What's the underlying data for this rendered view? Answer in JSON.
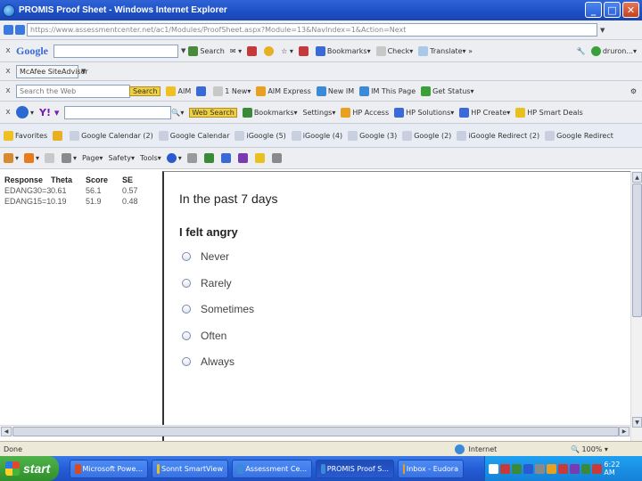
{
  "window": {
    "title": "PROMIS Proof Sheet - Windows Internet Explorer"
  },
  "address": {
    "url": "https://www.assessmentcenter.net/ac1/Modules/ProofSheet.aspx?Module=13&NavIndex=1&Action=Next"
  },
  "google_bar": {
    "brand": "Google",
    "search": "Search",
    "bookmarks": "Bookmarks",
    "check": "Check",
    "translate": "Translate",
    "user": "druron..."
  },
  "mcafee_bar": {
    "label": "McAfee SiteAdvisor"
  },
  "aim_bar": {
    "search_placeholder": "Search the Web",
    "search_button": "Search",
    "aim": "AIM",
    "new": "1 New",
    "aim_express": "AIM Express",
    "new_im": "New IM",
    "im_this_page": "IM This Page",
    "get_status": "Get Status"
  },
  "yahoo_bar": {
    "web_search": "Web Search",
    "bookmarks": "Bookmarks",
    "settings": "Settings",
    "hp_access": "HP Access",
    "hp_solutions": "HP Solutions",
    "hp_create": "HP Create",
    "hp_smart_deals": "HP Smart Deals"
  },
  "favorites_bar": {
    "favorites": "Favorites",
    "links": [
      "Google Calendar (2)",
      "Google Calendar",
      "iGoogle (5)",
      "iGoogle (4)",
      "Google (3)",
      "Google (2)",
      "iGoogle Redirect (2)",
      "Google Redirect"
    ]
  },
  "command_bar": {
    "page": "Page",
    "safety": "Safety",
    "tools": "Tools"
  },
  "results_table": {
    "headers": [
      "Response",
      "Theta",
      "Score",
      "SE"
    ],
    "rows": [
      [
        "EDANG30=3",
        "0.61",
        "56.1",
        "0.57"
      ],
      [
        "EDANG15=1",
        "0.19",
        "51.9",
        "0.48"
      ]
    ]
  },
  "question": {
    "heading": "In the past 7 days",
    "item": "I felt angry",
    "options": [
      "Never",
      "Rarely",
      "Sometimes",
      "Often",
      "Always"
    ]
  },
  "status": {
    "left": "Done",
    "zone": "Internet",
    "zoom": "100%"
  },
  "taskbar": {
    "start": "start",
    "tasks": [
      "Microsoft Powe...",
      "Sonnt SmartView",
      "Assessment Ce...",
      "PROMIS Proof S...",
      "Inbox - Eudora"
    ],
    "clock": "6:22 AM"
  },
  "colors": {
    "titlebar": "#1d4fc4",
    "taskbar": "#245ed8",
    "start": "#2f8f2a",
    "toolbar": "#edeef2"
  }
}
